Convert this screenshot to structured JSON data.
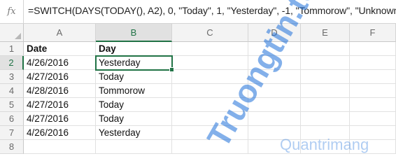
{
  "formula_bar": {
    "fx_label": "fx",
    "formula": "=SWITCH(DAYS(TODAY(), A2), 0, \"Today\", 1, \"Yesterday\", -1, \"Tommorow\", \"Unknown\")"
  },
  "columns": [
    "A",
    "B",
    "C",
    "D",
    "E",
    "F"
  ],
  "selected_column": "B",
  "selected_row": "2",
  "rows": [
    {
      "num": "1",
      "a": "Date",
      "b": "Day"
    },
    {
      "num": "2",
      "a": "4/26/2016",
      "b": "Yesterday"
    },
    {
      "num": "3",
      "a": "4/27/2016",
      "b": "Today"
    },
    {
      "num": "4",
      "a": "4/28/2016",
      "b": "Tommorow"
    },
    {
      "num": "5",
      "a": "4/27/2016",
      "b": "Today"
    },
    {
      "num": "6",
      "a": "4/27/2016",
      "b": "Today"
    },
    {
      "num": "7",
      "a": "4/26/2016",
      "b": "Yesterday"
    },
    {
      "num": "8",
      "a": "",
      "b": ""
    }
  ],
  "watermark": {
    "text": "Truongtin.top",
    "subtext": "Quantrimang",
    "color_main": "#1e6fd9",
    "color_accent": "#e8502f"
  }
}
